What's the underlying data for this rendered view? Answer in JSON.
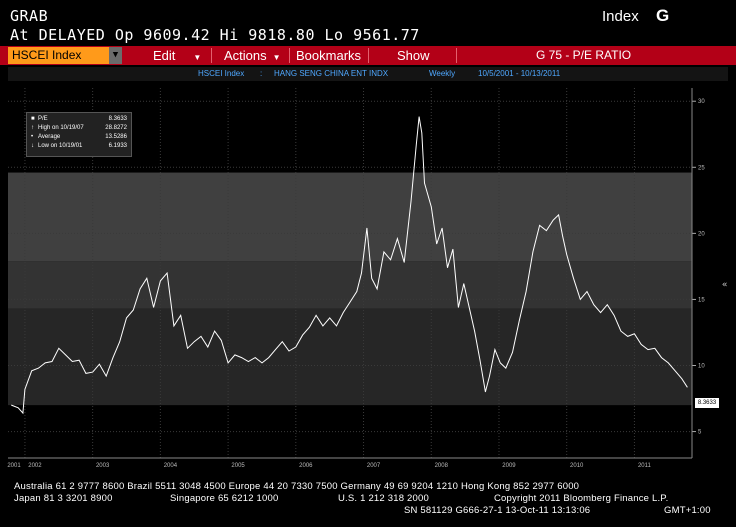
{
  "header": {
    "line1": "GRAB",
    "line2": "At DELAYED  Op 9609.42 Hi 9818.80 Lo 9561.77",
    "mode": "Index",
    "key": "G"
  },
  "toolbar": {
    "ticker": "HSCEI Index",
    "menus": [
      {
        "label": "Edit"
      },
      {
        "label": "Actions"
      },
      {
        "label": "Bookmarks"
      },
      {
        "label": "Show"
      }
    ],
    "function_title": "G 75 - P/E RATIO"
  },
  "infobar": {
    "security": "HSCEI Index",
    "sep": ":",
    "name": "HANG SENG CHINA ENT INDX",
    "freq": "Weekly",
    "range": "10/5/2001  -  10/13/2011"
  },
  "legend": {
    "series": "P/E",
    "last": "8.3633",
    "high_label": "High on 10/19/07",
    "high": "28.8272",
    "avg_label": "Average",
    "avg": "13.5286",
    "low_label": "Low on 10/19/01",
    "low": "6.1933"
  },
  "colors": {
    "menubar": "#b30017",
    "ticker": "#ff9a1a",
    "infotext": "#4fa8ff",
    "line": "#ffffff"
  },
  "chart_data": {
    "type": "line",
    "series": [
      {
        "name": "P/E",
        "points": [
          [
            2001.8,
            7.0
          ],
          [
            2001.9,
            6.8
          ],
          [
            2001.97,
            6.4
          ],
          [
            2002.0,
            8.2
          ],
          [
            2002.1,
            9.6
          ],
          [
            2002.2,
            9.8
          ],
          [
            2002.3,
            10.2
          ],
          [
            2002.4,
            10.3
          ],
          [
            2002.5,
            11.3
          ],
          [
            2002.6,
            10.8
          ],
          [
            2002.7,
            10.3
          ],
          [
            2002.8,
            10.4
          ],
          [
            2002.9,
            9.4
          ],
          [
            2003.0,
            9.5
          ],
          [
            2003.1,
            10.1
          ],
          [
            2003.2,
            9.2
          ],
          [
            2003.3,
            10.6
          ],
          [
            2003.4,
            11.8
          ],
          [
            2003.5,
            13.6
          ],
          [
            2003.6,
            14.2
          ],
          [
            2003.7,
            15.8
          ],
          [
            2003.8,
            16.6
          ],
          [
            2003.9,
            14.4
          ],
          [
            2004.0,
            16.4
          ],
          [
            2004.1,
            17.0
          ],
          [
            2004.15,
            15.0
          ],
          [
            2004.2,
            13.0
          ],
          [
            2004.3,
            13.8
          ],
          [
            2004.4,
            11.3
          ],
          [
            2004.5,
            11.8
          ],
          [
            2004.6,
            12.2
          ],
          [
            2004.7,
            11.4
          ],
          [
            2004.8,
            12.6
          ],
          [
            2004.9,
            11.9
          ],
          [
            2005.0,
            10.2
          ],
          [
            2005.1,
            10.8
          ],
          [
            2005.2,
            10.6
          ],
          [
            2005.3,
            10.3
          ],
          [
            2005.4,
            10.6
          ],
          [
            2005.5,
            10.2
          ],
          [
            2005.6,
            10.6
          ],
          [
            2005.7,
            11.2
          ],
          [
            2005.8,
            11.8
          ],
          [
            2005.9,
            11.1
          ],
          [
            2006.0,
            11.4
          ],
          [
            2006.1,
            12.3
          ],
          [
            2006.2,
            12.9
          ],
          [
            2006.3,
            13.8
          ],
          [
            2006.4,
            13.0
          ],
          [
            2006.5,
            13.6
          ],
          [
            2006.6,
            13.0
          ],
          [
            2006.7,
            14.0
          ],
          [
            2006.8,
            14.8
          ],
          [
            2006.9,
            15.6
          ],
          [
            2006.97,
            17.0
          ],
          [
            2007.05,
            20.4
          ],
          [
            2007.12,
            16.6
          ],
          [
            2007.2,
            15.8
          ],
          [
            2007.3,
            18.6
          ],
          [
            2007.4,
            18.0
          ],
          [
            2007.5,
            19.6
          ],
          [
            2007.6,
            17.8
          ],
          [
            2007.7,
            22.4
          ],
          [
            2007.78,
            26.8
          ],
          [
            2007.82,
            28.83
          ],
          [
            2007.86,
            27.6
          ],
          [
            2007.9,
            23.8
          ],
          [
            2008.0,
            22.0
          ],
          [
            2008.08,
            19.2
          ],
          [
            2008.16,
            20.4
          ],
          [
            2008.24,
            17.4
          ],
          [
            2008.32,
            18.8
          ],
          [
            2008.4,
            14.4
          ],
          [
            2008.48,
            16.2
          ],
          [
            2008.56,
            14.4
          ],
          [
            2008.64,
            12.6
          ],
          [
            2008.72,
            10.4
          ],
          [
            2008.8,
            8.0
          ],
          [
            2008.86,
            9.2
          ],
          [
            2008.94,
            11.2
          ],
          [
            2009.02,
            10.2
          ],
          [
            2009.1,
            9.8
          ],
          [
            2009.2,
            11.0
          ],
          [
            2009.3,
            13.4
          ],
          [
            2009.4,
            15.6
          ],
          [
            2009.5,
            18.6
          ],
          [
            2009.6,
            20.6
          ],
          [
            2009.7,
            20.2
          ],
          [
            2009.8,
            21.0
          ],
          [
            2009.88,
            21.4
          ],
          [
            2009.94,
            19.8
          ],
          [
            2010.0,
            18.4
          ],
          [
            2010.1,
            16.6
          ],
          [
            2010.2,
            15.0
          ],
          [
            2010.3,
            15.6
          ],
          [
            2010.4,
            14.6
          ],
          [
            2010.5,
            14.0
          ],
          [
            2010.6,
            14.6
          ],
          [
            2010.7,
            13.8
          ],
          [
            2010.8,
            12.6
          ],
          [
            2010.9,
            12.2
          ],
          [
            2011.0,
            12.4
          ],
          [
            2011.1,
            11.6
          ],
          [
            2011.2,
            11.2
          ],
          [
            2011.3,
            11.3
          ],
          [
            2011.4,
            10.6
          ],
          [
            2011.5,
            10.2
          ],
          [
            2011.6,
            9.6
          ],
          [
            2011.7,
            9.0
          ],
          [
            2011.78,
            8.36
          ]
        ]
      }
    ],
    "xlim": [
      2001.75,
      2011.85
    ],
    "ylim": [
      3,
      31
    ],
    "x_ticks": [
      "2001",
      "2002",
      "2003",
      "2004",
      "2005",
      "2006",
      "2007",
      "2008",
      "2009",
      "2010",
      "2011"
    ],
    "y_ticks": [
      "5",
      "10",
      "15",
      "20",
      "25",
      "30"
    ],
    "bands": [
      {
        "from": 7.0,
        "to": 14.3,
        "color": "#262626"
      },
      {
        "from": 14.3,
        "to": 17.9,
        "color": "#333333"
      },
      {
        "from": 17.9,
        "to": 24.6,
        "color": "#404040"
      }
    ],
    "last_value_label": "8.3633",
    "grid": true
  },
  "footer": {
    "line1": "Australia 61 2 9777 8600 Brazil 5511 3048 4500 Europe 44 20 7330 7500 Germany 49 69 9204 1210 Hong Kong 852 2977 6000",
    "line2a": "Japan 81 3 3201 8900",
    "line2b": "Singapore 65 6212 1000",
    "line2c": "U.S. 1 212 318 2000",
    "line2d": "Copyright 2011 Bloomberg Finance L.P.",
    "line3a": "SN 581129 G666-27-1 13-Oct-11 13:13:06",
    "line3b": "GMT+1:00"
  }
}
